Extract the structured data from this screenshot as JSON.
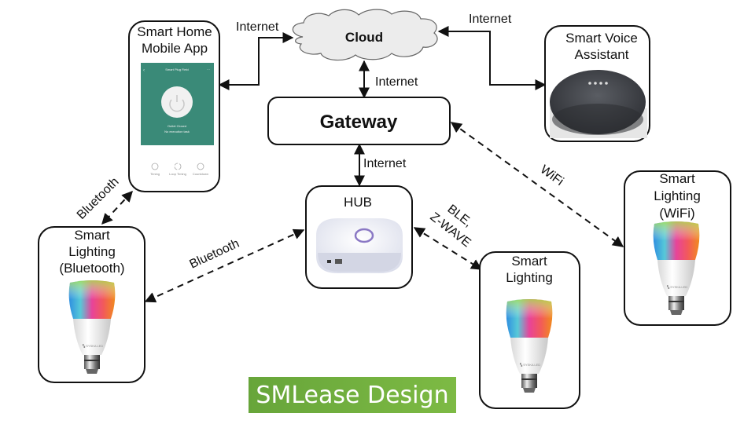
{
  "nodes": {
    "cloud": {
      "label": "Cloud"
    },
    "gateway": {
      "label": "Gateway"
    },
    "mobile_app": {
      "label_lines": [
        "Smart Home",
        "Mobile App"
      ],
      "screen": {
        "title": "Smart Plug Field",
        "status": "Outlet Closed",
        "substatus": "No execution task",
        "actions": [
          "Timing",
          "Loop Timing",
          "Countdown"
        ]
      }
    },
    "voice_assistant": {
      "label_lines": [
        "Smart Voice",
        "Assistant"
      ]
    },
    "hub": {
      "label": "HUB"
    },
    "lighting_bluetooth": {
      "label_lines": [
        "Smart",
        "Lighting",
        "(Bluetooth)"
      ]
    },
    "lighting": {
      "label_lines": [
        "Smart",
        "Lighting"
      ]
    },
    "lighting_wifi": {
      "label_lines": [
        "Smart",
        "Lighting",
        "(WiFi)"
      ]
    }
  },
  "edges": [
    {
      "from": "mobile_app",
      "to": "cloud",
      "label": "Internet",
      "style": "solid",
      "direction": "both"
    },
    {
      "from": "voice_assistant",
      "to": "cloud",
      "label": "Internet",
      "style": "solid",
      "direction": "both"
    },
    {
      "from": "cloud",
      "to": "gateway",
      "label": "Internet",
      "style": "solid",
      "direction": "both"
    },
    {
      "from": "gateway",
      "to": "hub",
      "label": "Internet",
      "style": "solid",
      "direction": "both"
    },
    {
      "from": "gateway",
      "to": "lighting_wifi",
      "label": "WiFi",
      "style": "dashed",
      "direction": "both"
    },
    {
      "from": "mobile_app",
      "to": "lighting_bluetooth",
      "label": "Bluetooth",
      "style": "dashed",
      "direction": "both"
    },
    {
      "from": "hub",
      "to": "lighting_bluetooth",
      "label": "Bluetooth",
      "style": "dashed",
      "direction": "both"
    },
    {
      "from": "hub",
      "to": "lighting",
      "label_lines": [
        "BLE,",
        "Z-WAVE"
      ],
      "style": "dashed",
      "direction": "both"
    }
  ],
  "brand": {
    "text": "SMLease Design",
    "color": "#6fae3e"
  }
}
